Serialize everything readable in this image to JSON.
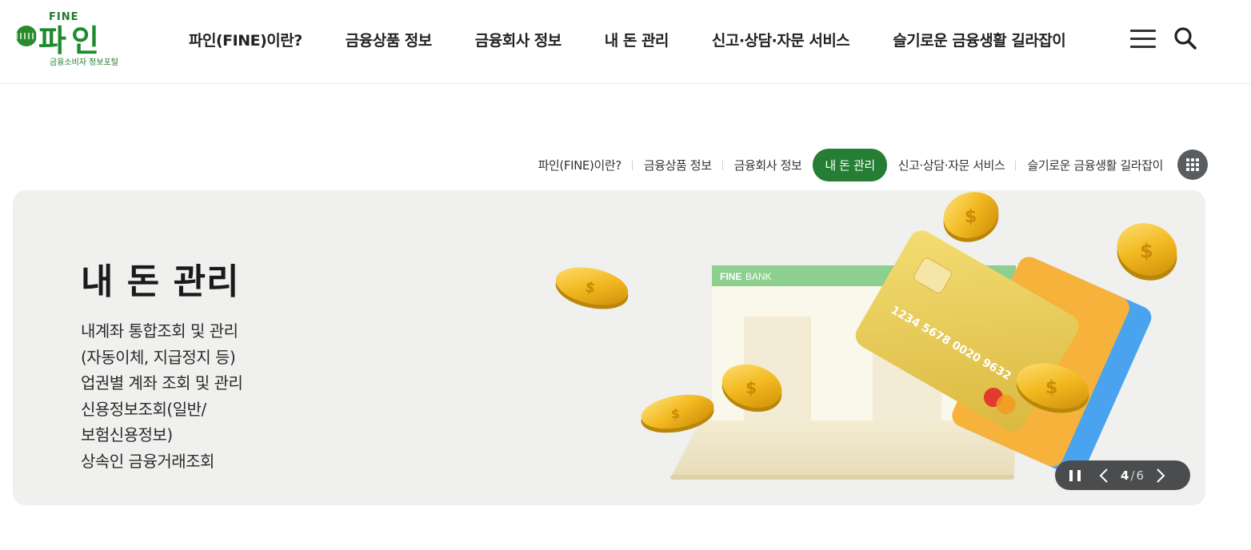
{
  "logo": {
    "top_text": "FINE",
    "main_text": "파인",
    "sub_text": "금융소비자 정보포털",
    "brand_color": "#1e8a2e"
  },
  "gnb": {
    "items": [
      {
        "label": "파인(FINE)이란?"
      },
      {
        "label": "금융상품 정보"
      },
      {
        "label": "금융회사 정보"
      },
      {
        "label": "내 돈 관리"
      },
      {
        "label": "신고·상담·자문 서비스"
      },
      {
        "label": "슬기로운 금융생활 길라잡이"
      }
    ],
    "menu_icon": "hamburger-menu-icon",
    "search_icon": "search-icon"
  },
  "subnav": {
    "items": [
      {
        "label": "파인(FINE)이란?",
        "active": false
      },
      {
        "label": "금융상품 정보",
        "active": false
      },
      {
        "label": "금융회사 정보",
        "active": false
      },
      {
        "label": "내 돈 관리",
        "active": true
      },
      {
        "label": "신고·상담·자문 서비스",
        "active": false
      },
      {
        "label": "슬기로운 금융생활 길라잡이",
        "active": false
      }
    ],
    "grid_icon": "grid-icon",
    "active_color": "#267e35"
  },
  "banner": {
    "title": "내 돈 관리",
    "desc_lines": [
      "내계좌 통합조회 및 관리",
      "(자동이체, 지급정지 등)",
      "업권별 계좌 조회 및 관리",
      "신용정보조회(일반/",
      "보험신용정보)",
      "상속인 금융거래조회"
    ],
    "illustration": {
      "bank_label_bold": "FINE",
      "bank_label": "BANK",
      "card_number": "1234 5678 0020 9632"
    },
    "background_color": "#f0f0ef"
  },
  "slider": {
    "current": "4",
    "separator": "/",
    "total": "6",
    "pause_icon": "pause-icon",
    "prev_icon": "chevron-left-icon",
    "next_icon": "chevron-right-icon"
  }
}
